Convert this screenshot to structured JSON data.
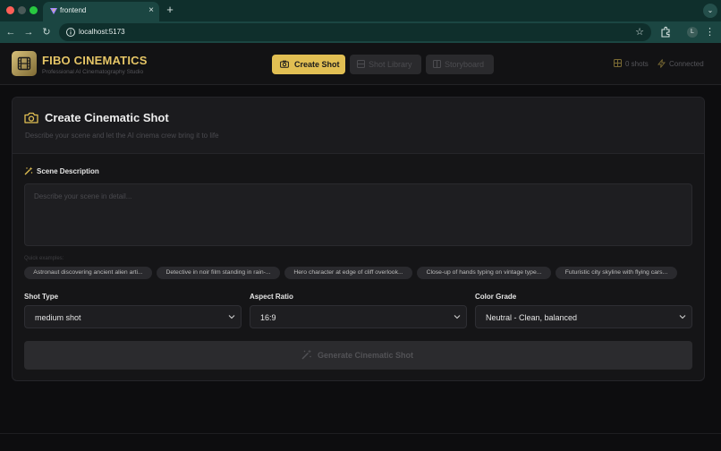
{
  "browser": {
    "tab_title": "frontend",
    "url": "localhost:5173",
    "profile_initial": "L"
  },
  "app": {
    "brand": "FIBO CINEMATICS",
    "tagline": "Professional AI Cinematography Studio",
    "accent_color": "#e1bf53",
    "nav": {
      "create_shot": "Create Shot",
      "shot_library": "Shot Library",
      "storyboard": "Storyboard"
    },
    "status": {
      "shots": "0 shots",
      "connection": "Connected"
    }
  },
  "card": {
    "title": "Create Cinematic Shot",
    "subtitle": "Describe your scene and let the AI cinema crew bring it to life",
    "scene_label": "Scene Description",
    "scene_placeholder": "Describe your scene in detail...",
    "quick_label": "Quick examples:",
    "examples": [
      "Astronaut discovering ancient alien arti...",
      "Detective in noir film standing in rain-...",
      "Hero character at edge of cliff overlook...",
      "Close-up of hands typing on vintage type...",
      "Futuristic city skyline with flying cars..."
    ],
    "fields": {
      "shot_type": {
        "label": "Shot Type",
        "value": "medium shot"
      },
      "aspect_ratio": {
        "label": "Aspect Ratio",
        "value": "16:9"
      },
      "color_grade": {
        "label": "Color Grade",
        "value": "Neutral - Clean, balanced"
      }
    },
    "generate_label": "Generate Cinematic Shot"
  }
}
